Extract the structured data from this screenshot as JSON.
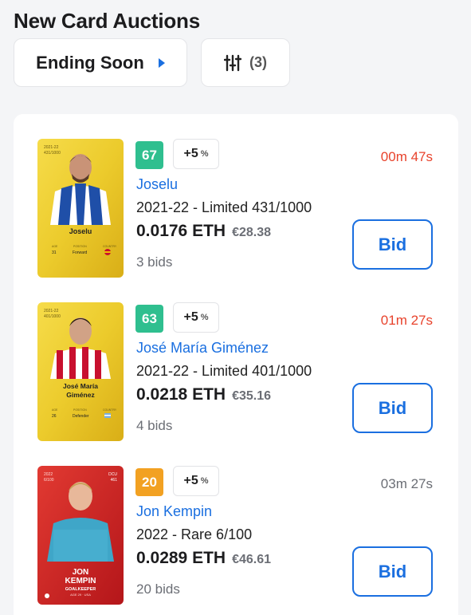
{
  "header": {
    "title": "New Card Auctions"
  },
  "toolbar": {
    "sort_label": "Ending Soon",
    "filter_count": "(3)"
  },
  "colors": {
    "accent": "#1a6fe0",
    "urgent": "#e8432c",
    "score_green": "#2fbf8f",
    "score_orange": "#f2a122"
  },
  "auctions": [
    {
      "score": "67",
      "score_color": "#2fbf8f",
      "bonus": "+5",
      "bonus_unit": "%",
      "player": "Joselu",
      "edition": "2021-22 - Limited 431/1000",
      "price_eth": "0.0176 ETH",
      "price_fiat": "€28.38",
      "bids": "3 bids",
      "timer": "00m 47s",
      "timer_color": "#e8432c",
      "bid_label": "Bid",
      "card": {
        "style": "limited",
        "season": "2021-22",
        "serial": "431/1000",
        "name_line1": "Joselu",
        "name_line2": "",
        "age": "31",
        "position": "Forward",
        "age_label": "AGE",
        "position_label": "POSITION",
        "country_label": "COUNTRY"
      }
    },
    {
      "score": "63",
      "score_color": "#2fbf8f",
      "bonus": "+5",
      "bonus_unit": "%",
      "player": "José María Giménez",
      "edition": "2021-22 - Limited 401/1000",
      "price_eth": "0.0218 ETH",
      "price_fiat": "€35.16",
      "bids": "4 bids",
      "timer": "01m 27s",
      "timer_color": "#e8432c",
      "bid_label": "Bid",
      "card": {
        "style": "limited",
        "season": "2021-22",
        "serial": "401/1000",
        "name_line1": "José María",
        "name_line2": "Giménez",
        "age": "26",
        "position": "Defender",
        "age_label": "AGE",
        "position_label": "POSITION",
        "country_label": "COUNTRY"
      }
    },
    {
      "score": "20",
      "score_color": "#f2a122",
      "bonus": "+5",
      "bonus_unit": "%",
      "player": "Jon Kempin",
      "edition": "2022 - Rare 6/100",
      "price_eth": "0.0289 ETH",
      "price_fiat": "€46.61",
      "bids": "20 bids",
      "timer": "03m 27s",
      "timer_color": "#6b6e75",
      "bid_label": "Bid",
      "card": {
        "style": "rare",
        "season": "2022",
        "serial": "6/100",
        "name_line1": "JON",
        "name_line2": "KEMPIN",
        "position": "GOALKEEPER",
        "details": "AGE 29 · USA",
        "team_code": "DCU",
        "team_num": "461"
      }
    }
  ]
}
